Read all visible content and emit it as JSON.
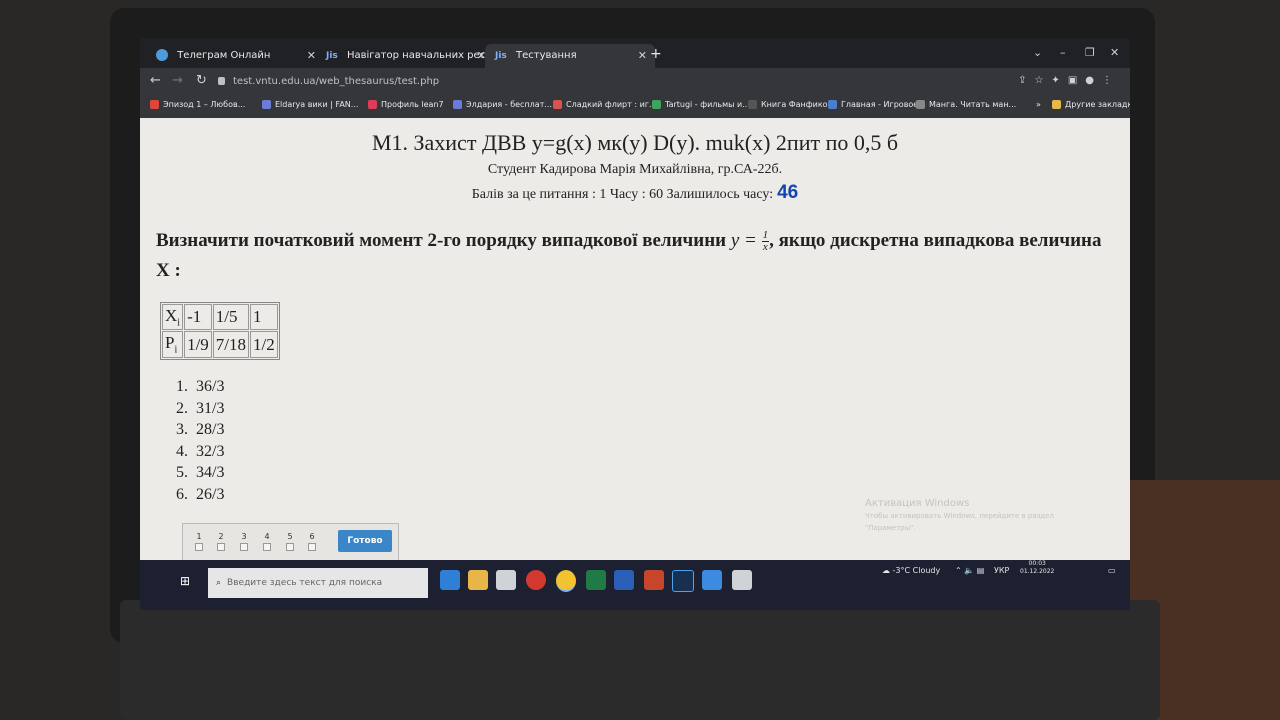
{
  "browser": {
    "tabs": [
      {
        "label": "Телеграм Онлайн",
        "active": false
      },
      {
        "label": "Навігатор навчальних ресурсів",
        "active": false
      },
      {
        "label": "Тестування",
        "active": true
      }
    ],
    "tab_prefix": "Jis",
    "address": "test.vntu.edu.ua/web_thesaurus/test.php",
    "bookmarks": [
      "Эпизод 1 – Любов...",
      "Eldarya вики | FAN...",
      "Профиль lean7",
      "Элдария - бесплат...",
      "Сладкий флирт : иг...",
      "Tartugi - фильмы и...",
      "Книга Фанфиков",
      "Главная - Игровое...",
      "Манга. Читать ман..."
    ],
    "other_bookmarks": "Другие закладки",
    "bookmarks_overflow": "»"
  },
  "test": {
    "title": "М1. Захист ДВВ y=g(x) мк(y) D(y). muk(x) 2пит по 0,5 б",
    "student": "Студент Кадирова Марія Михайлівна, гр.СА-22б.",
    "score_text": "Балів за це питання : 1 Часу : 60 Залишилось часу:",
    "timer": "46",
    "question_part1": "Визначити початковий момент 2-го порядку випадкової величини",
    "question_formula": "y = ",
    "formula_num": "1",
    "formula_den": "x",
    "question_part2": ", якщо дискретна випадкова величина X  :",
    "table": {
      "row1_label": "X",
      "row1_sub": "i",
      "row1_values": [
        "-1",
        "1/5",
        "1"
      ],
      "row2_label": "P",
      "row2_sub": "i",
      "row2_values": [
        "1/9",
        "7/18",
        "1/2"
      ]
    },
    "answers": [
      {
        "num": "1.",
        "text": "36/3"
      },
      {
        "num": "2.",
        "text": "31/3"
      },
      {
        "num": "3.",
        "text": "28/3"
      },
      {
        "num": "4.",
        "text": "32/3"
      },
      {
        "num": "5.",
        "text": "34/3"
      },
      {
        "num": "6.",
        "text": "26/3"
      }
    ],
    "question_numbers": [
      "1",
      "2",
      "3",
      "4",
      "5",
      "6"
    ],
    "done_button": "Готово"
  },
  "windows_activation": {
    "title": "Активация Windows",
    "line1": "Чтобы активировать Windows, перейдите в раздел",
    "line2": "\"Параметры\"."
  },
  "taskbar": {
    "search_placeholder": "Введите здесь текст для поиска",
    "weather": "-3°C  Cloudy",
    "lang": "УКР",
    "time": "00:03",
    "date": "01.12.2022"
  }
}
